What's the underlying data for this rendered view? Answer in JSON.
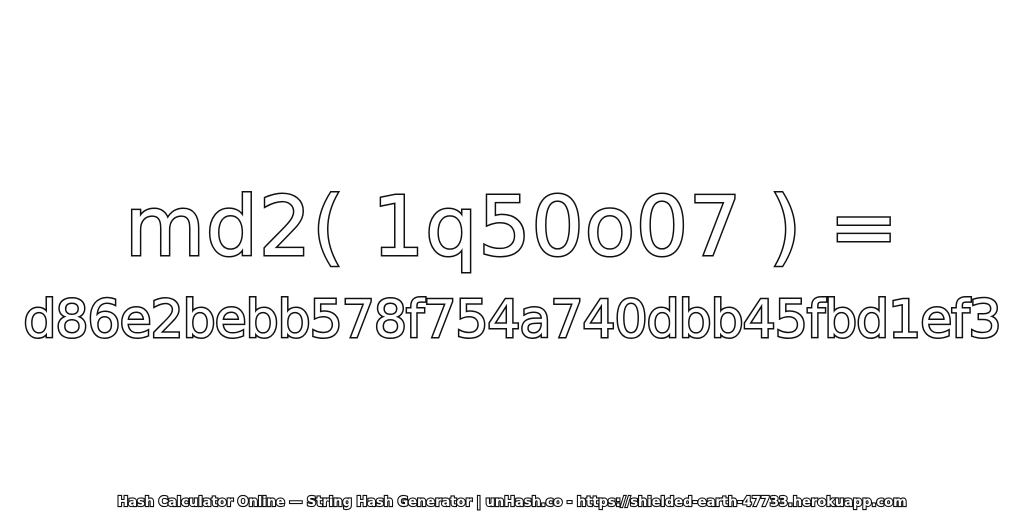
{
  "hash": {
    "expression": "md2( 1q50o07 ) =",
    "digest": "d86e2bebb578f754a740dbb45fbd1ef3"
  },
  "footer": {
    "text": "Hash Calculator Online — String Hash Generator | unHash.co - https://shielded-earth-47733.herokuapp.com"
  },
  "colors": {
    "background": "#ffffff",
    "text_fill": "#ffffff",
    "text_outline": "#111111"
  }
}
